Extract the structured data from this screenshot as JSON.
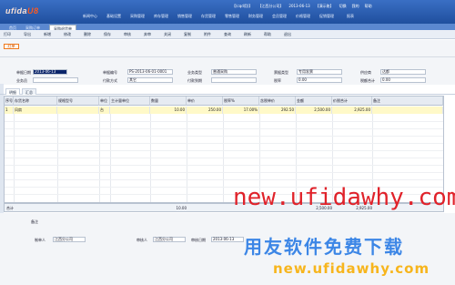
{
  "header": {
    "logo_text": "ufida",
    "logo_accent": "U8",
    "info": [
      "【(cqd用)】",
      "【江西分公司】",
      "2013-06-13",
      "【演示账】",
      "切换",
      "我的",
      "帮助"
    ],
    "nav": [
      "新闻中心",
      "基础设置",
      "采购管理",
      "库存管理",
      "销售管理",
      "存货管理",
      "零售管理",
      "财务管理",
      "会员管理",
      "价格管理",
      "促销管理",
      "报表"
    ]
  },
  "tabs": [
    "首页",
    "采购订单",
    "采购退货单"
  ],
  "toolbar": [
    "打印",
    "导出",
    "新增",
    "修改",
    "删除",
    "保存",
    "审核",
    "弃审",
    "关闭",
    "复制",
    "附件",
    "查询",
    "刷新",
    "帮助",
    "退出"
  ],
  "badge": "红单",
  "form": {
    "date_label": "单据日期",
    "date_value": "2013-06-13",
    "no_label": "单据编号",
    "no_value": "PS-2013-06-01-0001",
    "biztype_label": "业务类型",
    "biztype_value": "普通采购",
    "invtype_label": "票据类型",
    "invtype_value": "专用发票",
    "supplier_label": "供应商",
    "supplier_value": "达都",
    "staff_label": "业务员",
    "paymode_label": "付款方式",
    "paymode_value": "其它",
    "paydate_label": "付款到期",
    "rate_label": "税率",
    "rate_value": "0.00",
    "tax_label": "税额合计",
    "tax_value": "0.00"
  },
  "grid_tabs": [
    "明细",
    "汇总"
  ],
  "grid": {
    "headers": [
      "序号",
      "存货名称",
      "规格型号",
      "单位",
      "主计量单位",
      "数量",
      "单价",
      "税率%",
      "含税单价",
      "金额",
      "价税合计",
      "备注"
    ],
    "rows": [
      [
        "1",
        "风扇",
        "",
        "台",
        "",
        "10.00",
        "250.00",
        "17.00%",
        "292.50",
        "2,500.00",
        "2,925.00",
        ""
      ]
    ]
  },
  "totals": {
    "label": "合计",
    "qty": "10.00",
    "amount": "2,500.00",
    "sum": "2,925.00"
  },
  "footer": {
    "remark_label": "备注",
    "maker_label": "制单人",
    "maker_value": "江西分公司",
    "auditor_label": "审核人",
    "auditor_value": "江西分公司",
    "auditdate_label": "审核日期",
    "auditdate_value": "2013-06-13"
  },
  "watermark": {
    "line1": "new.ufidawhy.com",
    "line2": "用友软件免费下载",
    "line3": "new.ufidawhy.com"
  }
}
